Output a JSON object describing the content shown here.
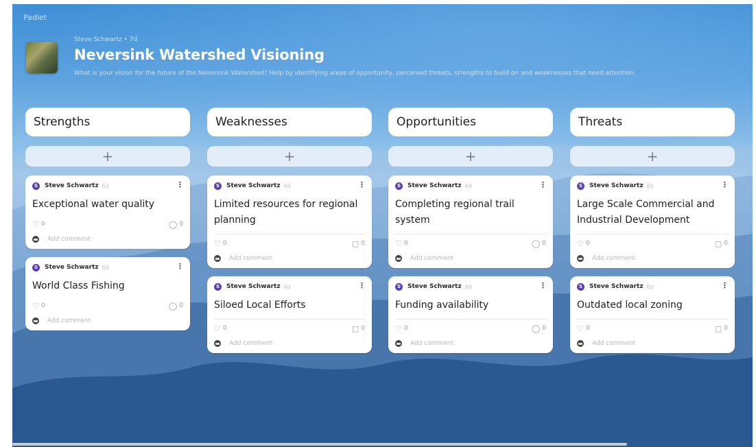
{
  "brand": "Padlet",
  "header": {
    "author_line": "Steve Schwartz • 7d",
    "title": "Neversink Watershed Visioning",
    "description": "What is your vision for the future of the Neversink Watershed? Help by identifying areas of opportunity, perceived threats, strengths to build on and weaknesses that need attention."
  },
  "add_label": "+",
  "comment_placeholder": "Add comment",
  "columns": [
    {
      "title": "Strengths",
      "cards": [
        {
          "avatar": "S",
          "author": "Steve Schwartz",
          "time": "6d",
          "title": "Exceptional water quality",
          "likes": "0",
          "comments": "0"
        },
        {
          "avatar": "S",
          "author": "Steve Schwartz",
          "time": "6d",
          "title": "World Class Fishing",
          "likes": "0",
          "comments": "0"
        }
      ]
    },
    {
      "title": "Weaknesses",
      "cards": [
        {
          "avatar": "S",
          "author": "Steve Schwartz",
          "time": "6d",
          "title": "Limited resources for regional planning",
          "likes": "0",
          "comments": "0"
        },
        {
          "avatar": "S",
          "author": "Steve Schwartz",
          "time": "6d",
          "title": "Siloed Local Efforts",
          "likes": "0",
          "comments": "0"
        }
      ]
    },
    {
      "title": "Opportunities",
      "cards": [
        {
          "avatar": "S",
          "author": "Steve Schwartz",
          "time": "6d",
          "title": "Completing regional trail system",
          "likes": "0",
          "comments": "0"
        },
        {
          "avatar": "S",
          "author": "Steve Schwartz",
          "time": "6d",
          "title": "Funding availability",
          "likes": "0",
          "comments": "0"
        }
      ]
    },
    {
      "title": "Threats",
      "cards": [
        {
          "avatar": "S",
          "author": "Steve Schwartz",
          "time": "6d",
          "title": "Large Scale Commercial and Industrial Development",
          "likes": "0",
          "comments": "0"
        },
        {
          "avatar": "S",
          "author": "Steve Schwartz",
          "time": "6d",
          "title": "Outdated local zoning",
          "likes": "0",
          "comments": "0"
        }
      ]
    }
  ],
  "icons": {
    "like": "heart-icon",
    "comment": "comment-bubble-icon",
    "more": "kebab-menu-icon",
    "add": "plus-icon"
  },
  "colors": {
    "avatar_purple": "#5b3fb5",
    "sky_top": "#3f8fd6",
    "sky_bottom": "#1f4f86"
  }
}
